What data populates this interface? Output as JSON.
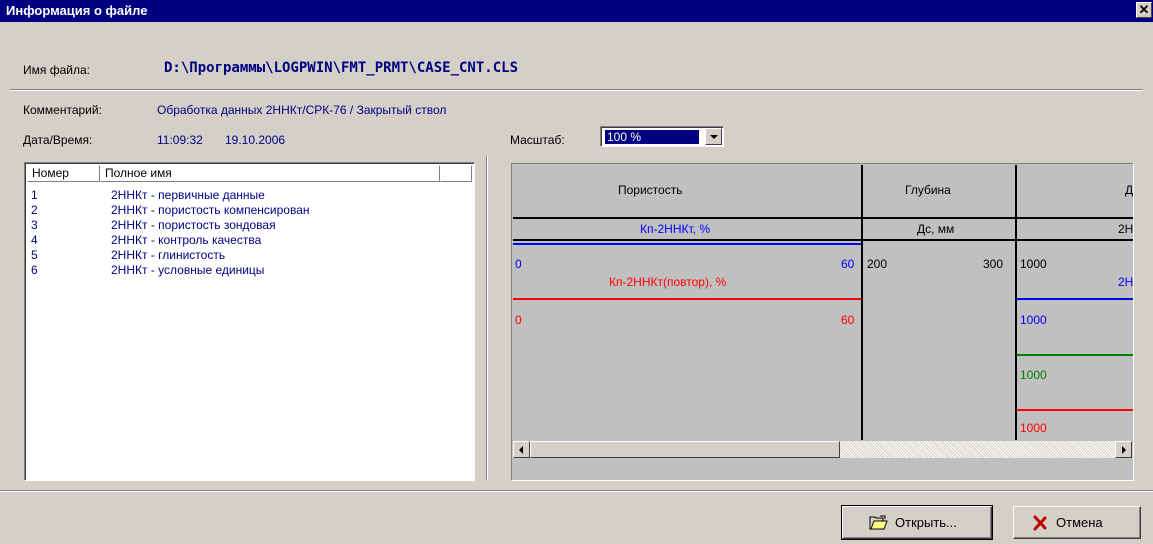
{
  "window": {
    "title": "Информация о файле",
    "close_glyph": "✕"
  },
  "file": {
    "name_label": "Имя файла:",
    "path": "D:\\Программы\\LOGPWIN\\FMT_PRMT\\CASE_CNT.CLS"
  },
  "comment": {
    "label": "Комментарий:",
    "value": "Обработка данных 2ННКт/СРК-76 / Закрытый ствол"
  },
  "datetime": {
    "label": "Дата/Время:",
    "time": "11:09:32",
    "date": "19.10.2006"
  },
  "scale": {
    "label": "Масштаб:",
    "value": "100 %"
  },
  "list": {
    "columns": [
      "Номер",
      "Полное имя"
    ],
    "rows": [
      {
        "num": "1",
        "name": "2ННКт - первичные данные"
      },
      {
        "num": "2",
        "name": "2ННКт - пористость компенсирован"
      },
      {
        "num": "3",
        "name": "2ННКт - пористость зондовая"
      },
      {
        "num": "4",
        "name": "2ННКт - контроль качества"
      },
      {
        "num": "5",
        "name": "2ННКт - глинистость"
      },
      {
        "num": "6",
        "name": "2ННКт - условные единицы"
      }
    ]
  },
  "preview": {
    "track1": {
      "title": "Пористость",
      "curve1": {
        "name": "Кп-2ННКт, %",
        "min": "0",
        "max": "60",
        "color": "#0000ff"
      },
      "curve2": {
        "name": "Кп-2ННКт(повтор), %",
        "min": "0",
        "max": "60",
        "color": "#ff0000"
      }
    },
    "track2": {
      "title": "Глубина",
      "name": "Дс, мм",
      "min": "200",
      "max": "300"
    },
    "track3": {
      "title": "Д",
      "name": "2Н",
      "v1": "1000",
      "v1b": "2Н",
      "v2": "1000",
      "v3": "1000",
      "v4": "1000"
    }
  },
  "buttons": {
    "open": "Открыть...",
    "cancel": "Отмена"
  },
  "colors": {
    "title_bar": "#000080",
    "text_blue": "#000080",
    "green_curve": "#008000"
  }
}
